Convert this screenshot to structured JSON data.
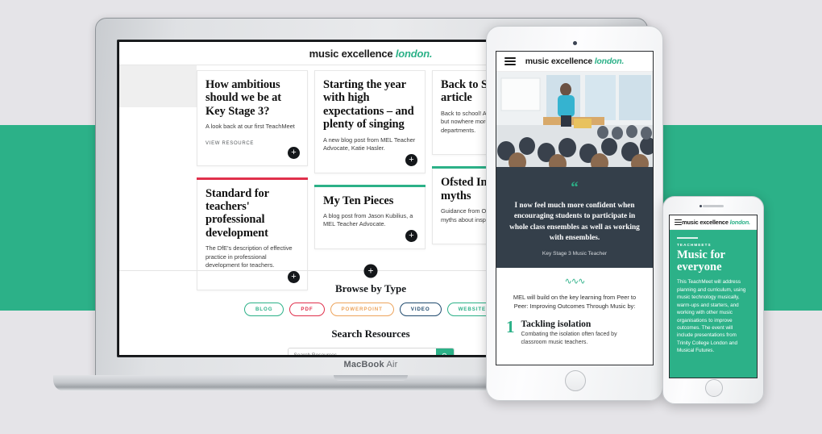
{
  "scene": {
    "background_color": "#e5e4e8",
    "band_color": "#2cb188"
  },
  "brand": {
    "part1": "music excellence ",
    "part2": "london."
  },
  "laptop": {
    "model_label_bold": "MacBook",
    "model_label_light": " Air",
    "cards": [
      {
        "title": "How ambitious should we be at Key Stage 3?",
        "desc": "A look back at our first TeachMeet",
        "meta": "VIEW RESOURCE",
        "accent": "",
        "plus": "+"
      },
      {
        "title": "Standard for teachers' professional development",
        "desc": "The DfE's description of effective practice in professional development for teachers.",
        "meta": "",
        "accent": "#e0304c",
        "plus": "+"
      },
      {
        "title": "Starting the year with high expectations – and plenty of singing",
        "desc": "A new blog post from MEL Teacher Advocate, Katie Hasler.",
        "meta": "",
        "accent": "",
        "plus": "+"
      },
      {
        "title": "My Ten Pieces",
        "desc": "A blog post from Jason Kubilius, a MEL Teacher Advocate.",
        "meta": "",
        "accent": "#2cb188",
        "plus": "+"
      },
      {
        "title": "Back to School article",
        "desc": "Back to school! And so it begins, but nowhere more so than in music departments.",
        "meta": "",
        "accent": "",
        "plus": "+"
      },
      {
        "title": "Ofsted Inspection myths",
        "desc": "Guidance from Ofsted on common myths about inspection.",
        "meta": "",
        "accent": "#2cb188",
        "plus": "+"
      }
    ],
    "expand_plus": "+",
    "browse": {
      "title": "Browse by Type",
      "pills": [
        {
          "label": "BLOG",
          "color": "#2cb188"
        },
        {
          "label": "PDF",
          "color": "#e0304c"
        },
        {
          "label": "POWERPOINT",
          "color": "#eda45c"
        },
        {
          "label": "VIDEO",
          "color": "#1f4a6e"
        },
        {
          "label": "WEBSITE",
          "color": "#2cb188"
        }
      ]
    },
    "search": {
      "title": "Search Resources",
      "placeholder": "Search Resources",
      "value": "",
      "button_icon": "search-icon"
    }
  },
  "tablet": {
    "hero_image_alt": "lecture-audience-photo",
    "quote": {
      "mark": "“",
      "text": "I now feel much more confident when encouraging students to participate in whole class ensembles as well as working with ensembles.",
      "attribution": "Key Stage 3 Music Teacher"
    },
    "lower": {
      "squiggle": "∿∿∿",
      "lead": "MEL will build on the key learning from Peer to Peer: Improving Outcomes Through Music by:",
      "item": {
        "number": "1",
        "title": "Tackling isolation",
        "desc": "Combating the isolation often faced by classroom music teachers."
      }
    }
  },
  "phone": {
    "kicker": "TEACHMEETS",
    "title": "Music for everyone",
    "body": "This TeachMeet will address planning and curriculum, using music technology musically, warm-ups and starters, and working with other music organisations to improve outcomes. The event will include presentations from Trinity College London and Musical Futures."
  }
}
